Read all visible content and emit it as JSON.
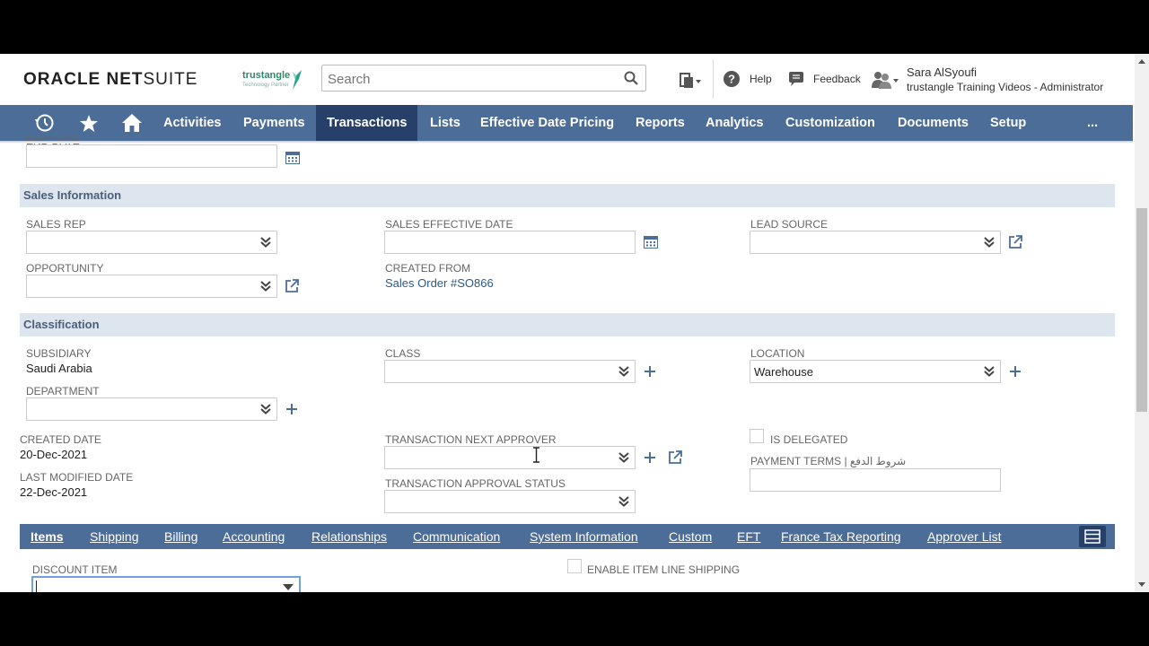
{
  "header": {
    "logo_bold": "ORACLE NET",
    "logo_light": "SUITE",
    "brand_name": "trustangle",
    "brand_sub": "Technology Partner",
    "search_placeholder": "Search",
    "help_label": "Help",
    "feedback_label": "Feedback",
    "user_name": "Sara AlSyoufi",
    "user_role": "trustangle Training Videos - Administrator"
  },
  "nav": {
    "items": [
      "Activities",
      "Payments",
      "Transactions",
      "Lists",
      "Effective Date Pricing",
      "Reports",
      "Analytics",
      "Customization",
      "Documents",
      "Setup"
    ],
    "active": "Transactions",
    "more": "..."
  },
  "form": {
    "end_date_label": "END DATE",
    "sales_section": "Sales Information",
    "sales_rep_label": "SALES REP",
    "sales_effective_date_label": "SALES EFFECTIVE DATE",
    "lead_source_label": "LEAD SOURCE",
    "opportunity_label": "OPPORTUNITY",
    "created_from_label": "CREATED FROM",
    "created_from_value": "Sales Order #SO866",
    "classification_section": "Classification",
    "subsidiary_label": "SUBSIDIARY",
    "subsidiary_value": "Saudi Arabia",
    "class_label": "CLASS",
    "location_label": "LOCATION",
    "location_value": "Warehouse",
    "department_label": "DEPARTMENT",
    "created_date_label": "CREATED DATE",
    "created_date_value": "20-Dec-2021",
    "last_modified_label": "LAST MODIFIED DATE",
    "last_modified_value": "22-Dec-2021",
    "next_approver_label": "TRANSACTION NEXT APPROVER",
    "approval_status_label": "TRANSACTION APPROVAL STATUS",
    "is_delegated_label": "IS DELEGATED",
    "payment_terms_label": "PAYMENT TERMS | شروط الدفع"
  },
  "subtabs": {
    "items": [
      "Items",
      "Shipping",
      "Billing",
      "Accounting",
      "Relationships",
      "Communication",
      "System Information",
      "Custom",
      "EFT",
      "France Tax Reporting",
      "Approver List"
    ],
    "active": "Items"
  },
  "items_tab": {
    "discount_item_label": "DISCOUNT ITEM",
    "enable_line_shipping_label": "ENABLE ITEM LINE SHIPPING"
  },
  "colors": {
    "nav_bg": "#4d6d99",
    "nav_active": "#27406a",
    "section_bg": "#dde5ef",
    "link": "#2a5a8a"
  }
}
